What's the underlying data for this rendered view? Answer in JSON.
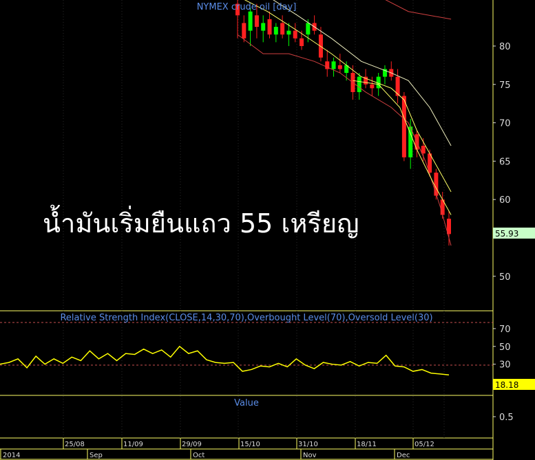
{
  "chart_data": [
    {
      "type": "candlestick",
      "title": "NYMEX crude oil [day]",
      "annotation": "น้ำมันเริ่มยืนแถว 55 เหรียญ",
      "last_value_label": "55.93",
      "colors": {
        "up": "#00ff00",
        "down": "#ff2020",
        "envelope_outer": "#d04040",
        "envelope_inner": "#ffff66",
        "band_outer": "#f0f0c0"
      },
      "yticks": [
        50,
        55,
        60,
        65,
        70,
        75,
        80
      ],
      "ytick_labels": [
        "50",
        "",
        "60",
        "65",
        "70",
        "75",
        "80"
      ],
      "ylim": [
        45.5,
        86.0
      ],
      "xlim": [
        -34,
        100
      ],
      "candles": [
        {
          "x": 0,
          "o": 85.5,
          "h": 86.0,
          "l": 81.0,
          "c": 84.0
        },
        {
          "x": 3,
          "o": 83.0,
          "h": 84.0,
          "l": 80.5,
          "c": 81.0
        },
        {
          "x": 6,
          "o": 82.0,
          "h": 85.0,
          "l": 80.0,
          "c": 84.5
        },
        {
          "x": 9,
          "o": 84.0,
          "h": 85.5,
          "l": 81.0,
          "c": 82.5
        },
        {
          "x": 12,
          "o": 82.0,
          "h": 84.0,
          "l": 80.5,
          "c": 83.0
        },
        {
          "x": 15,
          "o": 83.5,
          "h": 84.5,
          "l": 81.0,
          "c": 81.5
        },
        {
          "x": 18,
          "o": 81.5,
          "h": 83.0,
          "l": 80.5,
          "c": 82.5
        },
        {
          "x": 21,
          "o": 83.0,
          "h": 84.0,
          "l": 81.0,
          "c": 81.5
        },
        {
          "x": 24,
          "o": 81.5,
          "h": 83.0,
          "l": 80.0,
          "c": 82.0
        },
        {
          "x": 27,
          "o": 82.0,
          "h": 83.0,
          "l": 80.5,
          "c": 81.0
        },
        {
          "x": 30,
          "o": 81.0,
          "h": 82.0,
          "l": 79.5,
          "c": 80.0
        },
        {
          "x": 33,
          "o": 81.5,
          "h": 83.5,
          "l": 80.5,
          "c": 83.0
        },
        {
          "x": 36,
          "o": 83.0,
          "h": 84.0,
          "l": 81.5,
          "c": 82.0
        },
        {
          "x": 39,
          "o": 81.5,
          "h": 82.5,
          "l": 78.0,
          "c": 78.5
        },
        {
          "x": 42,
          "o": 78.0,
          "h": 79.5,
          "l": 76.0,
          "c": 77.0
        },
        {
          "x": 45,
          "o": 77.0,
          "h": 78.5,
          "l": 76.0,
          "c": 78.0
        },
        {
          "x": 48,
          "o": 77.5,
          "h": 79.0,
          "l": 76.5,
          "c": 77.0
        },
        {
          "x": 51,
          "o": 76.5,
          "h": 78.0,
          "l": 75.5,
          "c": 77.5
        },
        {
          "x": 54,
          "o": 76.5,
          "h": 77.5,
          "l": 73.0,
          "c": 74.0
        },
        {
          "x": 57,
          "o": 74.0,
          "h": 76.5,
          "l": 73.0,
          "c": 76.0
        },
        {
          "x": 60,
          "o": 76.0,
          "h": 77.0,
          "l": 74.5,
          "c": 75.0
        },
        {
          "x": 63,
          "o": 75.0,
          "h": 76.0,
          "l": 73.5,
          "c": 74.5
        },
        {
          "x": 66,
          "o": 74.5,
          "h": 76.5,
          "l": 73.5,
          "c": 76.0
        },
        {
          "x": 69,
          "o": 76.0,
          "h": 77.5,
          "l": 75.0,
          "c": 77.0
        },
        {
          "x": 72,
          "o": 77.0,
          "h": 78.0,
          "l": 75.5,
          "c": 76.0
        },
        {
          "x": 75,
          "o": 76.0,
          "h": 77.0,
          "l": 72.5,
          "c": 73.5
        },
        {
          "x": 78,
          "o": 73.5,
          "h": 74.0,
          "l": 65.0,
          "c": 65.5
        },
        {
          "x": 81,
          "o": 65.5,
          "h": 70.5,
          "l": 64.0,
          "c": 69.5
        },
        {
          "x": 84,
          "o": 68.5,
          "h": 69.0,
          "l": 65.5,
          "c": 66.5
        },
        {
          "x": 87,
          "o": 67.0,
          "h": 68.0,
          "l": 65.0,
          "c": 66.0
        },
        {
          "x": 90,
          "o": 66.0,
          "h": 66.5,
          "l": 63.0,
          "c": 63.5
        },
        {
          "x": 93,
          "o": 63.5,
          "h": 64.0,
          "l": 60.0,
          "c": 60.5
        },
        {
          "x": 96,
          "o": 60.0,
          "h": 61.0,
          "l": 57.5,
          "c": 58.0
        },
        {
          "x": 99,
          "o": 57.5,
          "h": 58.5,
          "l": 54.0,
          "c": 55.5
        }
      ],
      "envelope_outer_upper": [
        [
          52,
          88.0
        ],
        [
          66,
          86.5
        ],
        [
          80,
          84.5
        ],
        [
          90,
          84.0
        ],
        [
          100,
          83.5
        ]
      ],
      "envelope_lower": [
        [
          0,
          81.5
        ],
        [
          12,
          79.0
        ],
        [
          24,
          79.0
        ],
        [
          36,
          78.0
        ],
        [
          48,
          76.5
        ],
        [
          60,
          74.0
        ],
        [
          72,
          72.0
        ],
        [
          80,
          70.0
        ],
        [
          88,
          65.0
        ],
        [
          95,
          59.0
        ],
        [
          100,
          54.0
        ]
      ],
      "band_upper": [
        [
          0,
          88.5
        ],
        [
          14,
          86.5
        ],
        [
          28,
          84.0
        ],
        [
          44,
          81.0
        ],
        [
          58,
          78.0
        ],
        [
          72,
          76.5
        ],
        [
          80,
          75.5
        ],
        [
          90,
          72.0
        ],
        [
          100,
          67.0
        ]
      ],
      "band_inner": [
        [
          0,
          86.5
        ],
        [
          14,
          84.5
        ],
        [
          28,
          82.0
        ],
        [
          44,
          79.0
        ],
        [
          58,
          76.0
        ],
        [
          72,
          74.5
        ],
        [
          78,
          73.0
        ],
        [
          84,
          69.0
        ],
        [
          92,
          65.0
        ],
        [
          100,
          61.0
        ]
      ],
      "band_lower_yellow": [
        [
          54,
          75.5
        ],
        [
          66,
          75.0
        ],
        [
          76,
          72.0
        ],
        [
          84,
          66.5
        ],
        [
          92,
          62.0
        ],
        [
          100,
          58.0
        ]
      ]
    },
    {
      "type": "line",
      "title": "Relative Strength Index(CLOSE,14,30,70),Overbought Level(70),Oversold Level(30)",
      "last_value_label": "18.18",
      "colors": {
        "line": "#ffff00",
        "levels": "#c85050"
      },
      "yticks": [
        30,
        50,
        70
      ],
      "levels": [
        70,
        30
      ],
      "ylim": [
        -5,
        90
      ],
      "x": [
        0,
        4,
        8,
        12,
        16,
        20,
        24,
        28,
        32,
        36,
        40,
        44,
        48,
        52,
        56,
        60,
        64,
        68,
        72,
        76,
        80,
        84,
        88,
        92,
        96,
        100,
        104,
        108,
        112,
        116,
        120,
        124,
        128,
        132,
        136,
        140,
        144,
        148,
        152,
        156,
        160,
        164,
        168,
        172,
        176,
        180,
        184,
        188,
        192,
        196,
        200
      ],
      "values": [
        30,
        32,
        36,
        26,
        39,
        30,
        36,
        31,
        38,
        34,
        45,
        36,
        42,
        34,
        42,
        41,
        47,
        42,
        46,
        38,
        50,
        42,
        45,
        35,
        32,
        31,
        32,
        22,
        24,
        28,
        27,
        31,
        27,
        36,
        29,
        25,
        32,
        30,
        29,
        33,
        28,
        32,
        31,
        40,
        28,
        27,
        22,
        24,
        20,
        19,
        18
      ]
    },
    {
      "type": "line",
      "title": "Value",
      "yticks_labels": [
        "0.5"
      ]
    }
  ],
  "x_axis": {
    "day_labels": [
      "25/08",
      "11/09",
      "29/09",
      "15/10",
      "31/10",
      "18/11",
      "05/12"
    ],
    "month_labels": [
      "2014",
      "Sep",
      "Oct",
      "Nov",
      "Dec"
    ]
  }
}
